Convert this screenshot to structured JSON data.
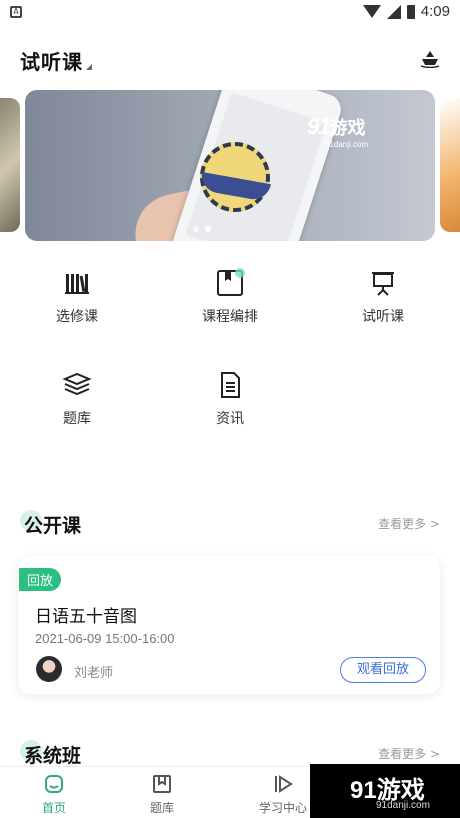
{
  "status_bar": {
    "time": "4:09",
    "left_icon": "A"
  },
  "header": {
    "title": "试听课"
  },
  "banner": {
    "watermark_logo": "91",
    "watermark_text": "游戏",
    "watermark_sub": "91danji.com",
    "slide_count": 2,
    "active_slide": 1
  },
  "nav": {
    "items": [
      {
        "label": "选修课",
        "icon": "books-icon"
      },
      {
        "label": "课程编排",
        "icon": "bookmark-book-icon"
      },
      {
        "label": "试听课",
        "icon": "presentation-board-icon"
      },
      {
        "label": "题库",
        "icon": "stack-icon"
      },
      {
        "label": "资讯",
        "icon": "document-icon"
      }
    ]
  },
  "public_course": {
    "title": "公开课",
    "more": "查看更多 >",
    "card": {
      "badge": "回放",
      "title": "日语五十音图",
      "datetime": "2021-06-09   15:00-16:00",
      "teacher": "刘老师",
      "button": "观看回放"
    }
  },
  "system_class": {
    "title": "系统班",
    "more": "查看更多 >"
  },
  "tabbar": {
    "items": [
      {
        "label": "首页",
        "icon": "home-icon",
        "active": true
      },
      {
        "label": "题库",
        "icon": "bookmark-icon",
        "active": false
      },
      {
        "label": "学习中心",
        "icon": "play-icon",
        "active": false
      }
    ]
  },
  "corner_watermark": {
    "logo": "91游戏",
    "sub": "91danji.com"
  },
  "colors": {
    "accent": "#2fa97a",
    "badge": "#2cbf82",
    "button_border": "#4a7fe0"
  }
}
